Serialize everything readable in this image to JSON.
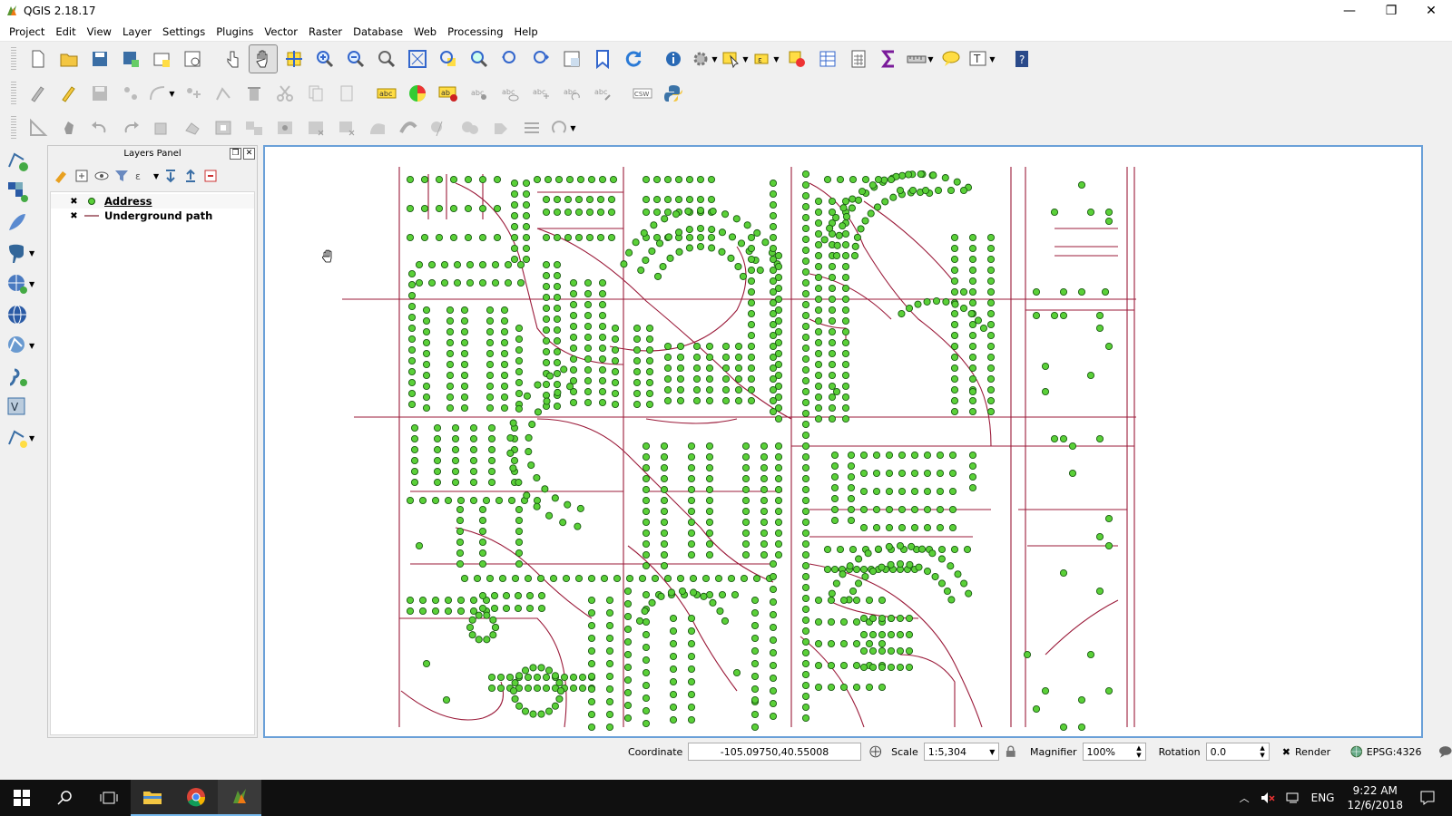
{
  "window": {
    "title": "QGIS 2.18.17",
    "minimize_glyph": "—",
    "restore_glyph": "❐",
    "close_glyph": "✕"
  },
  "menu": [
    "Project",
    "Edit",
    "View",
    "Layer",
    "Settings",
    "Plugins",
    "Vector",
    "Raster",
    "Database",
    "Web",
    "Processing",
    "Help"
  ],
  "layers_panel": {
    "title": "Layers Panel",
    "layers": [
      {
        "name": "Address",
        "checked_glyph": "✖",
        "symbol": "point",
        "color": "#44c044"
      },
      {
        "name": "Underground path",
        "checked_glyph": "✖",
        "symbol": "line",
        "color": "#7a1a2a"
      }
    ]
  },
  "status": {
    "coordinate_label": "Coordinate",
    "coordinate_value": "-105.09750,40.55008",
    "scale_label": "Scale",
    "scale_value": "1:5,304",
    "magnifier_label": "Magnifier",
    "magnifier_value": "100%",
    "rotation_label": "Rotation",
    "rotation_value": "0.0",
    "render_label": "Render",
    "render_checked_glyph": "✖",
    "crs": "EPSG:4326"
  },
  "taskbar": {
    "language": "ENG",
    "time": "9:22 AM",
    "date": "12/6/2018"
  },
  "colors": {
    "road": "#9b1b3a",
    "point_fill": "#5ad038",
    "point_stroke": "#1a5a12",
    "canvas_border": "#6aa0d8"
  }
}
